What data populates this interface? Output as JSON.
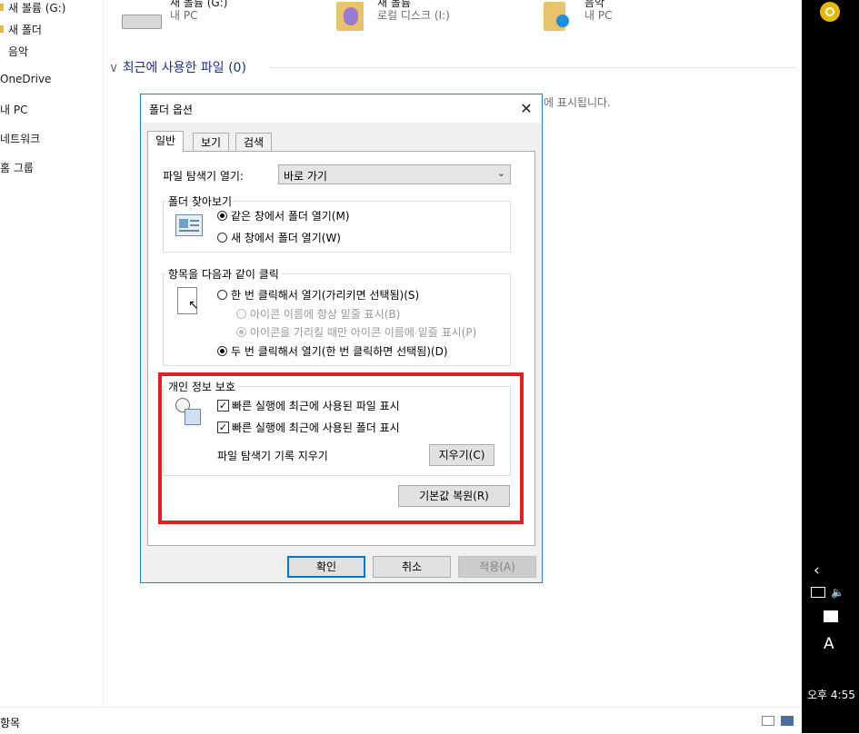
{
  "nav": {
    "items": [
      {
        "label": "새 볼륨 (G:)"
      },
      {
        "label": "새 폴더"
      },
      {
        "label": "음악"
      },
      {
        "label": "OneDrive"
      },
      {
        "label": "내 PC"
      },
      {
        "label": "네트워크"
      },
      {
        "label": "홈 그룹"
      }
    ]
  },
  "drives": [
    {
      "name": "새 볼륨 (G:)",
      "sub": "내 PC"
    },
    {
      "name": "새 볼륨",
      "sub": "로컬 디스크 (I:)"
    },
    {
      "name": "음악",
      "sub": "내 PC"
    }
  ],
  "recent": {
    "header": "최근에 사용한 파일 (0)",
    "note": "에 표시됩니다."
  },
  "statusbar": {
    "text": "항목"
  },
  "taskbar": {
    "time": "오후 4:55",
    "ime": "A"
  },
  "dialog": {
    "title": "폴더 옵션",
    "close": "✕",
    "tabs": [
      {
        "label": "일반"
      },
      {
        "label": "보기"
      },
      {
        "label": "검색"
      }
    ],
    "open_explorer_label": "파일 탐색기 열기:",
    "open_explorer_value": "바로 가기",
    "browse_group": {
      "label": "폴더 찾아보기",
      "options": [
        {
          "label": "같은 창에서 폴더 열기(M)",
          "checked": true
        },
        {
          "label": "새 창에서 폴더 열기(W)",
          "checked": false
        }
      ]
    },
    "click_group": {
      "label": "항목을 다음과 같이 클릭",
      "single": {
        "label": "한 번 클릭해서 열기(가리키면 선택됨)(S)",
        "checked": false
      },
      "underline_always": {
        "label": "아이콘 이름에 항상 밑줄 표시(B)",
        "checked": false
      },
      "underline_hover": {
        "label": "아이콘을 가리킬 때만 아이콘 이름에 밑줄 표시(P)",
        "checked": true
      },
      "double": {
        "label": "두 번 클릭해서 열기(한 번 클릭하면 선택됨)(D)",
        "checked": true
      }
    },
    "privacy_group": {
      "label": "개인 정보 보호",
      "show_recent_files": "빠른 실행에 최근에 사용된 파일 표시",
      "show_frequent_folders": "빠른 실행에 최근에 사용된 폴더 표시",
      "clear_history_label": "파일 탐색기 기록 지우기",
      "clear_button": "지우기(C)"
    },
    "restore_defaults": "기본값 복원(R)",
    "ok": "확인",
    "cancel": "취소",
    "apply": "적용(A)"
  },
  "colors": {
    "highlight": "#e31e24",
    "accent": "#0078d7"
  }
}
